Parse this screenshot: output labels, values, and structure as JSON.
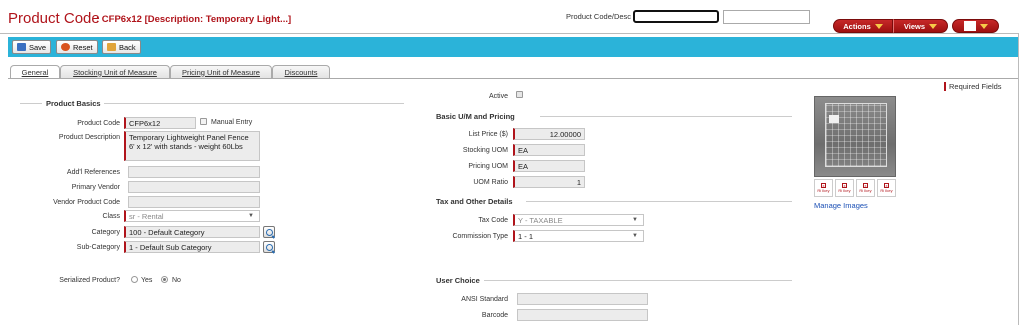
{
  "header": {
    "title": "Product Code",
    "subtitle": ": CFP6x12 [Description: Temporary Light...]",
    "search_label": "Product Code/Desc",
    "actions_label": "Actions",
    "views_label": "Views"
  },
  "toolbar": {
    "save_label": "Save",
    "reset_label": "Reset",
    "back_label": "Back"
  },
  "tabs": [
    {
      "label": "General"
    },
    {
      "label": "Stocking Unit of Measure"
    },
    {
      "label": "Pricing Unit of Measure"
    },
    {
      "label": "Discounts"
    }
  ],
  "required_fields": "Required Fields",
  "basics": {
    "title": "Product Basics",
    "product_code_label": "Product Code",
    "product_code": "CFP6x12",
    "manual_entry_label": "Manual Entry",
    "description_label": "Product Description",
    "description": "Temporary Lightweight Panel Fence 6' x 12' with stands - weight 60Lbs",
    "refs_label": "Add'l References",
    "refs": "",
    "vendor_label": "Primary Vendor",
    "vendor": "",
    "vendor_code_label": "Vendor Product Code",
    "vendor_code": "",
    "class_label": "Class",
    "class_value": "sr - Rental",
    "category_label": "Category",
    "category_value": "100 - Default Category",
    "subcategory_label": "Sub-Category",
    "subcategory_value": "1 - Default Sub Category",
    "serialized_label": "Serialized Product?",
    "yes_label": "Yes",
    "no_label": "No",
    "serialized_value": "No"
  },
  "middle": {
    "active_label": "Active",
    "active": true,
    "uom_title": "Basic U/M and Pricing",
    "list_price_label": "List Price ($)",
    "list_price": "12.00000",
    "stocking_uom_label": "Stocking UOM",
    "stocking_uom": "EA",
    "pricing_uom_label": "Pricing UOM",
    "pricing_uom": "EA",
    "uom_ratio_label": "UOM Ratio",
    "uom_ratio": "1",
    "tax_title": "Tax and Other Details",
    "tax_code_label": "Tax Code",
    "tax_code": "Y - TAXABLE",
    "commission_label": "Commission Type",
    "commission": "1 - 1",
    "user_title": "User Choice",
    "ansi_label": "ANSI Standard",
    "ansi": "",
    "barcode_label": "Barcode",
    "barcode": ""
  },
  "images": {
    "manage_label": "Manage Images",
    "thumb_labels": [
      "Ri Ikey",
      "Ri Ikey",
      "Ri Ikey",
      "Ri Ikey"
    ]
  },
  "colors": {
    "brand_red": "#b0141b",
    "toolbar_blue": "#2bb3d9",
    "link_blue": "#1a4fb5"
  }
}
